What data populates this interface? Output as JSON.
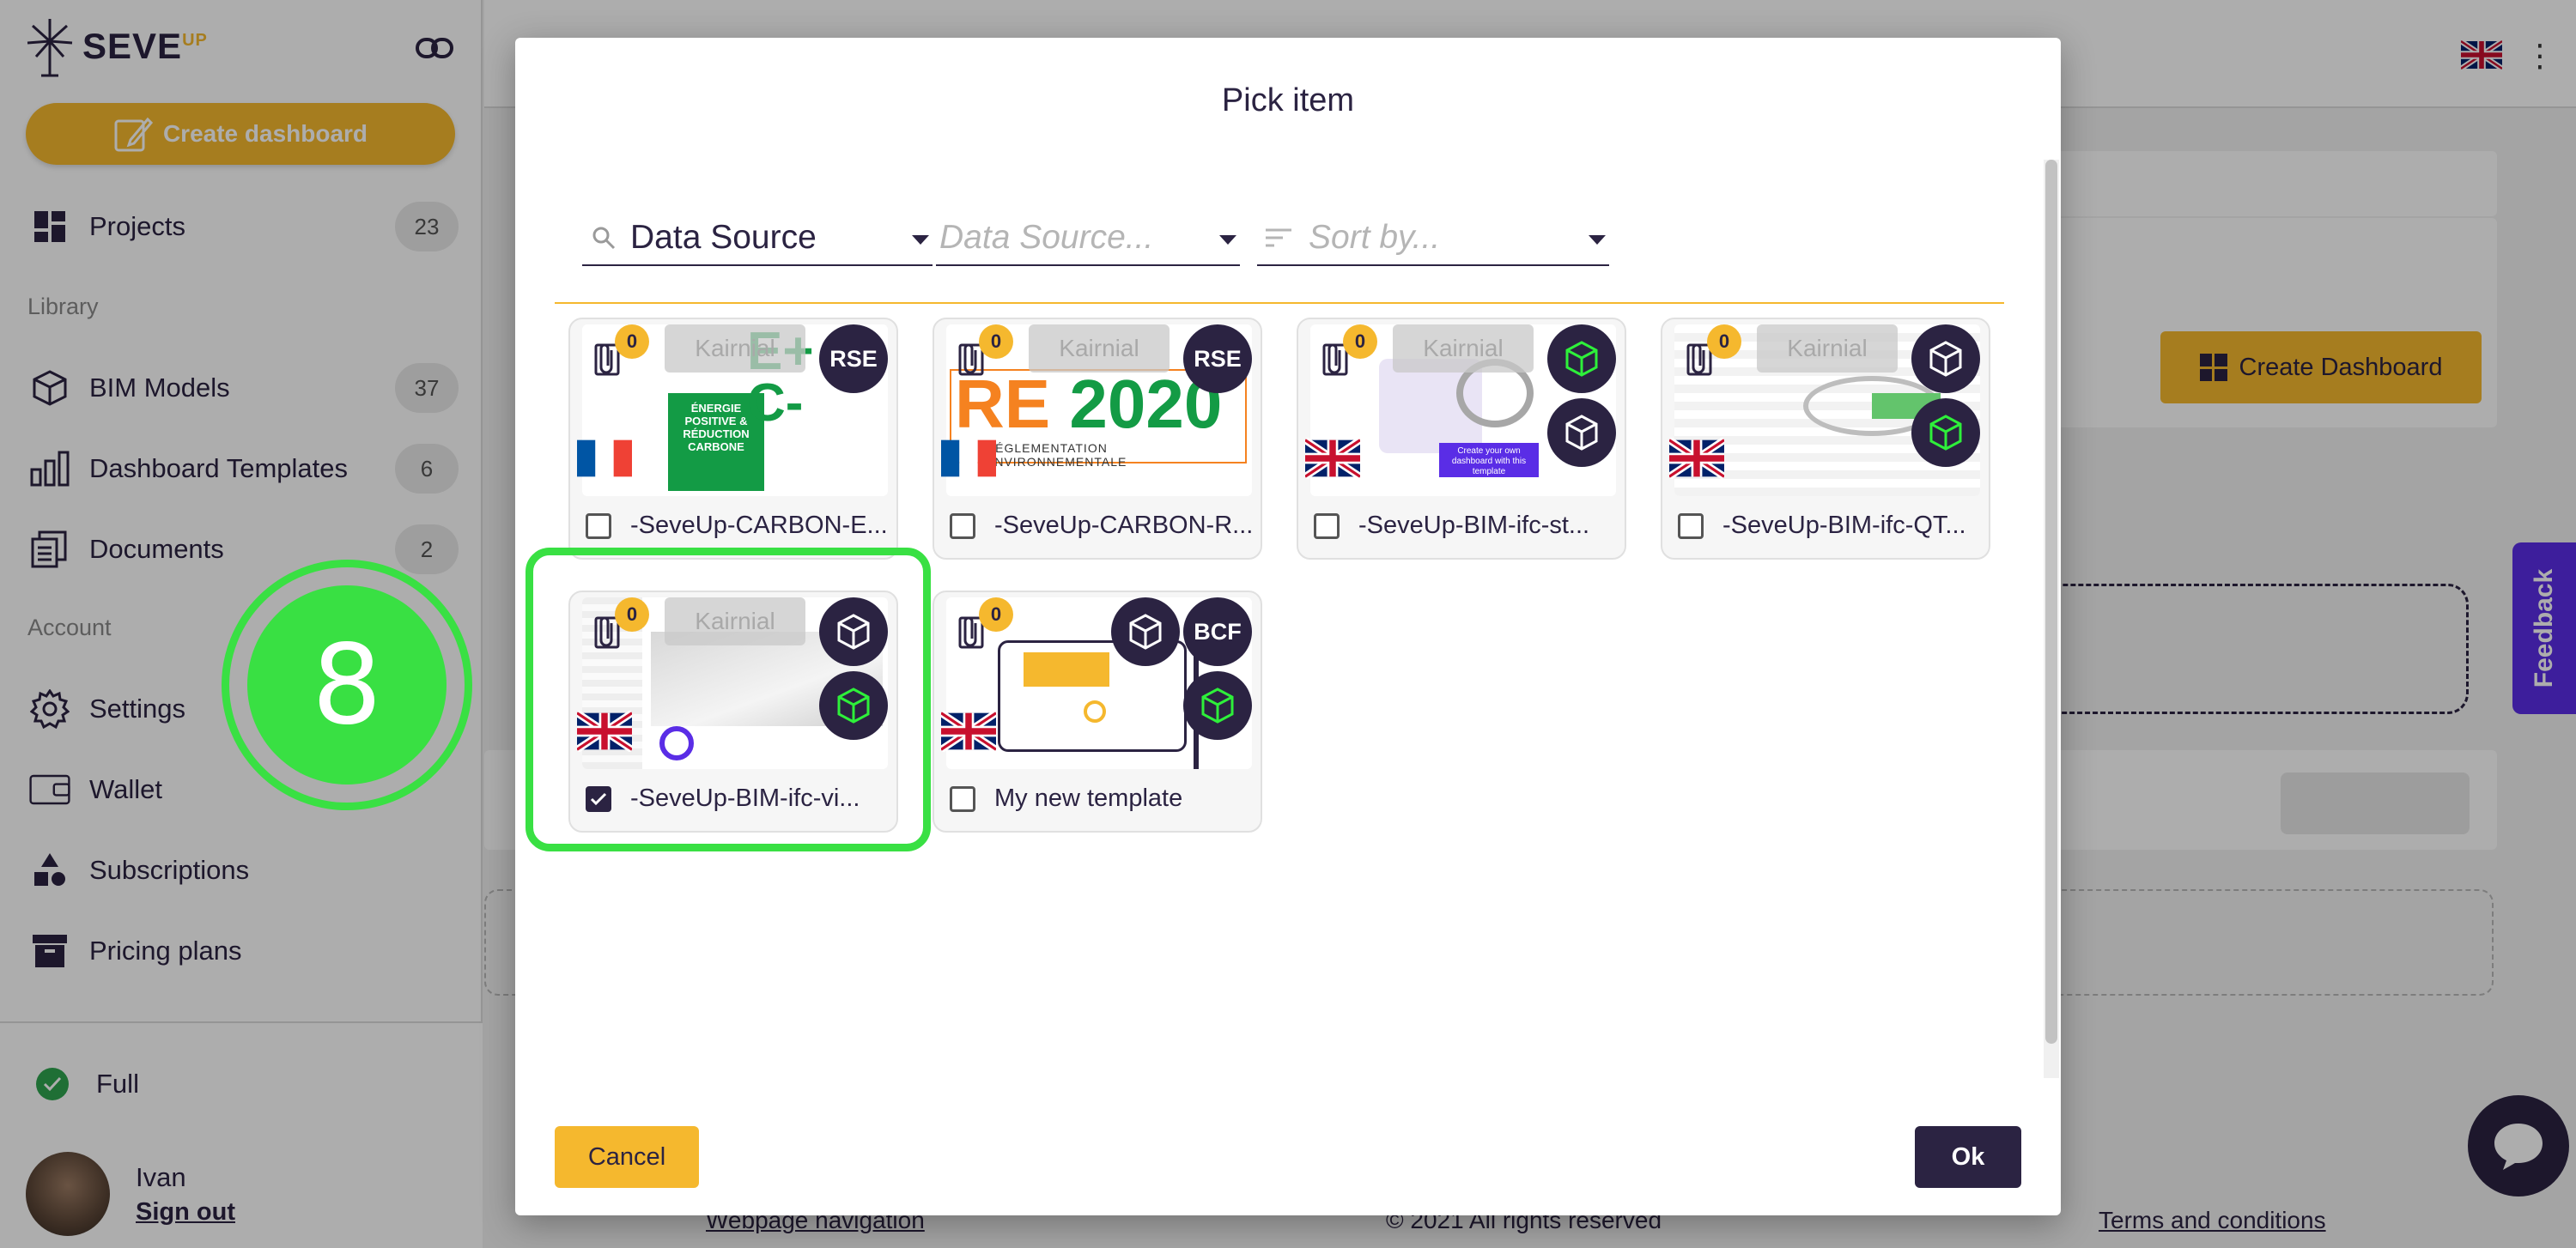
{
  "app": {
    "brand": "SEVE",
    "brand_sup": "UP"
  },
  "sidebar": {
    "create_label": "Create dashboard",
    "library_label": "Library",
    "account_label": "Account",
    "items": [
      {
        "label": "Projects",
        "count": "23"
      },
      {
        "label": "BIM Models",
        "count": "37"
      },
      {
        "label": "Dashboard Templates",
        "count": "6"
      },
      {
        "label": "Documents",
        "count": "2"
      },
      {
        "label": "Settings"
      },
      {
        "label": "Wallet"
      },
      {
        "label": "Subscriptions"
      },
      {
        "label": "Pricing plans"
      }
    ],
    "plan": "Full",
    "user_name": "Ivan",
    "sign_out": "Sign out"
  },
  "background": {
    "create_dashboard": "Create Dashboard",
    "footer_nav": "Webpage navigation",
    "footer_copy": "© 2021 All rights reserved",
    "footer_terms": "Terms and conditions",
    "feedback": "Feedback"
  },
  "modal": {
    "title": "Pick item",
    "filters": {
      "search_value": "Data Source",
      "second_placeholder": "Data Source...",
      "sort_placeholder": "Sort by..."
    },
    "cards": [
      {
        "label": "-SeveUp-CARBON-E...",
        "count": "0",
        "provider": "Kairnial",
        "badge": "RSE",
        "checked": false
      },
      {
        "label": "-SeveUp-CARBON-R...",
        "count": "0",
        "provider": "Kairnial",
        "badge": "RSE",
        "checked": false
      },
      {
        "label": "-SeveUp-BIM-ifc-st...",
        "count": "0",
        "provider": "Kairnial",
        "checked": false
      },
      {
        "label": "-SeveUp-BIM-ifc-QT...",
        "count": "0",
        "provider": "Kairnial",
        "checked": false
      },
      {
        "label": "-SeveUp-BIM-ifc-vi...",
        "count": "0",
        "provider": "Kairnial",
        "checked": true
      },
      {
        "label": "My new template",
        "count": "0",
        "badge": "BCF",
        "checked": false
      }
    ],
    "thumb_text": {
      "carbon_e": "E+ C-",
      "carbon_e_sub": "ÉNERGIE POSITIVE & RÉDUCTION CARBONE",
      "carbon_r": "RE 2020",
      "carbon_r_sub": "RÉGLEMENTATION ENVIRONNEMENTALE",
      "create_own": "Create your own dashboard with this template"
    },
    "cancel": "Cancel",
    "ok": "Ok"
  },
  "annotation": {
    "step": "8"
  },
  "colors": {
    "accent": "#f5b82e",
    "primary": "#2b2342",
    "highlight": "#39e043",
    "feedback": "#5a2de6"
  }
}
